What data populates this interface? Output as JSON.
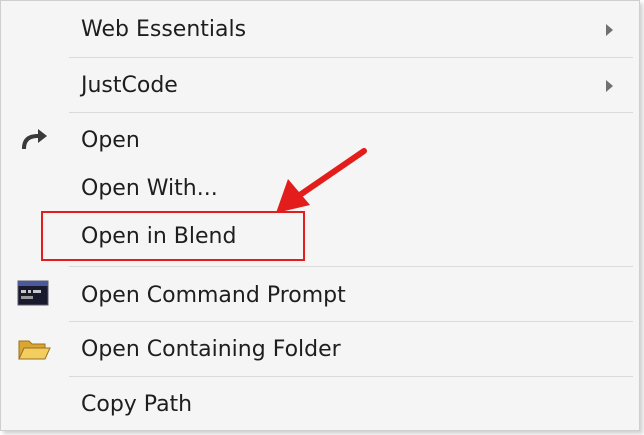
{
  "menu": {
    "items": [
      {
        "label": "Web Essentials",
        "submenu": true
      },
      {
        "label": "JustCode",
        "submenu": true
      },
      {
        "label": "Open",
        "icon": "redo-arrow-icon"
      },
      {
        "label": "Open With..."
      },
      {
        "label": "Open in Blend"
      },
      {
        "label": "Open Command Prompt",
        "icon": "command-prompt-icon"
      },
      {
        "label": "Open Containing Folder",
        "icon": "folder-icon"
      },
      {
        "label": "Copy Path"
      }
    ]
  },
  "annotation": {
    "highlight_color": "#e31c1c"
  }
}
